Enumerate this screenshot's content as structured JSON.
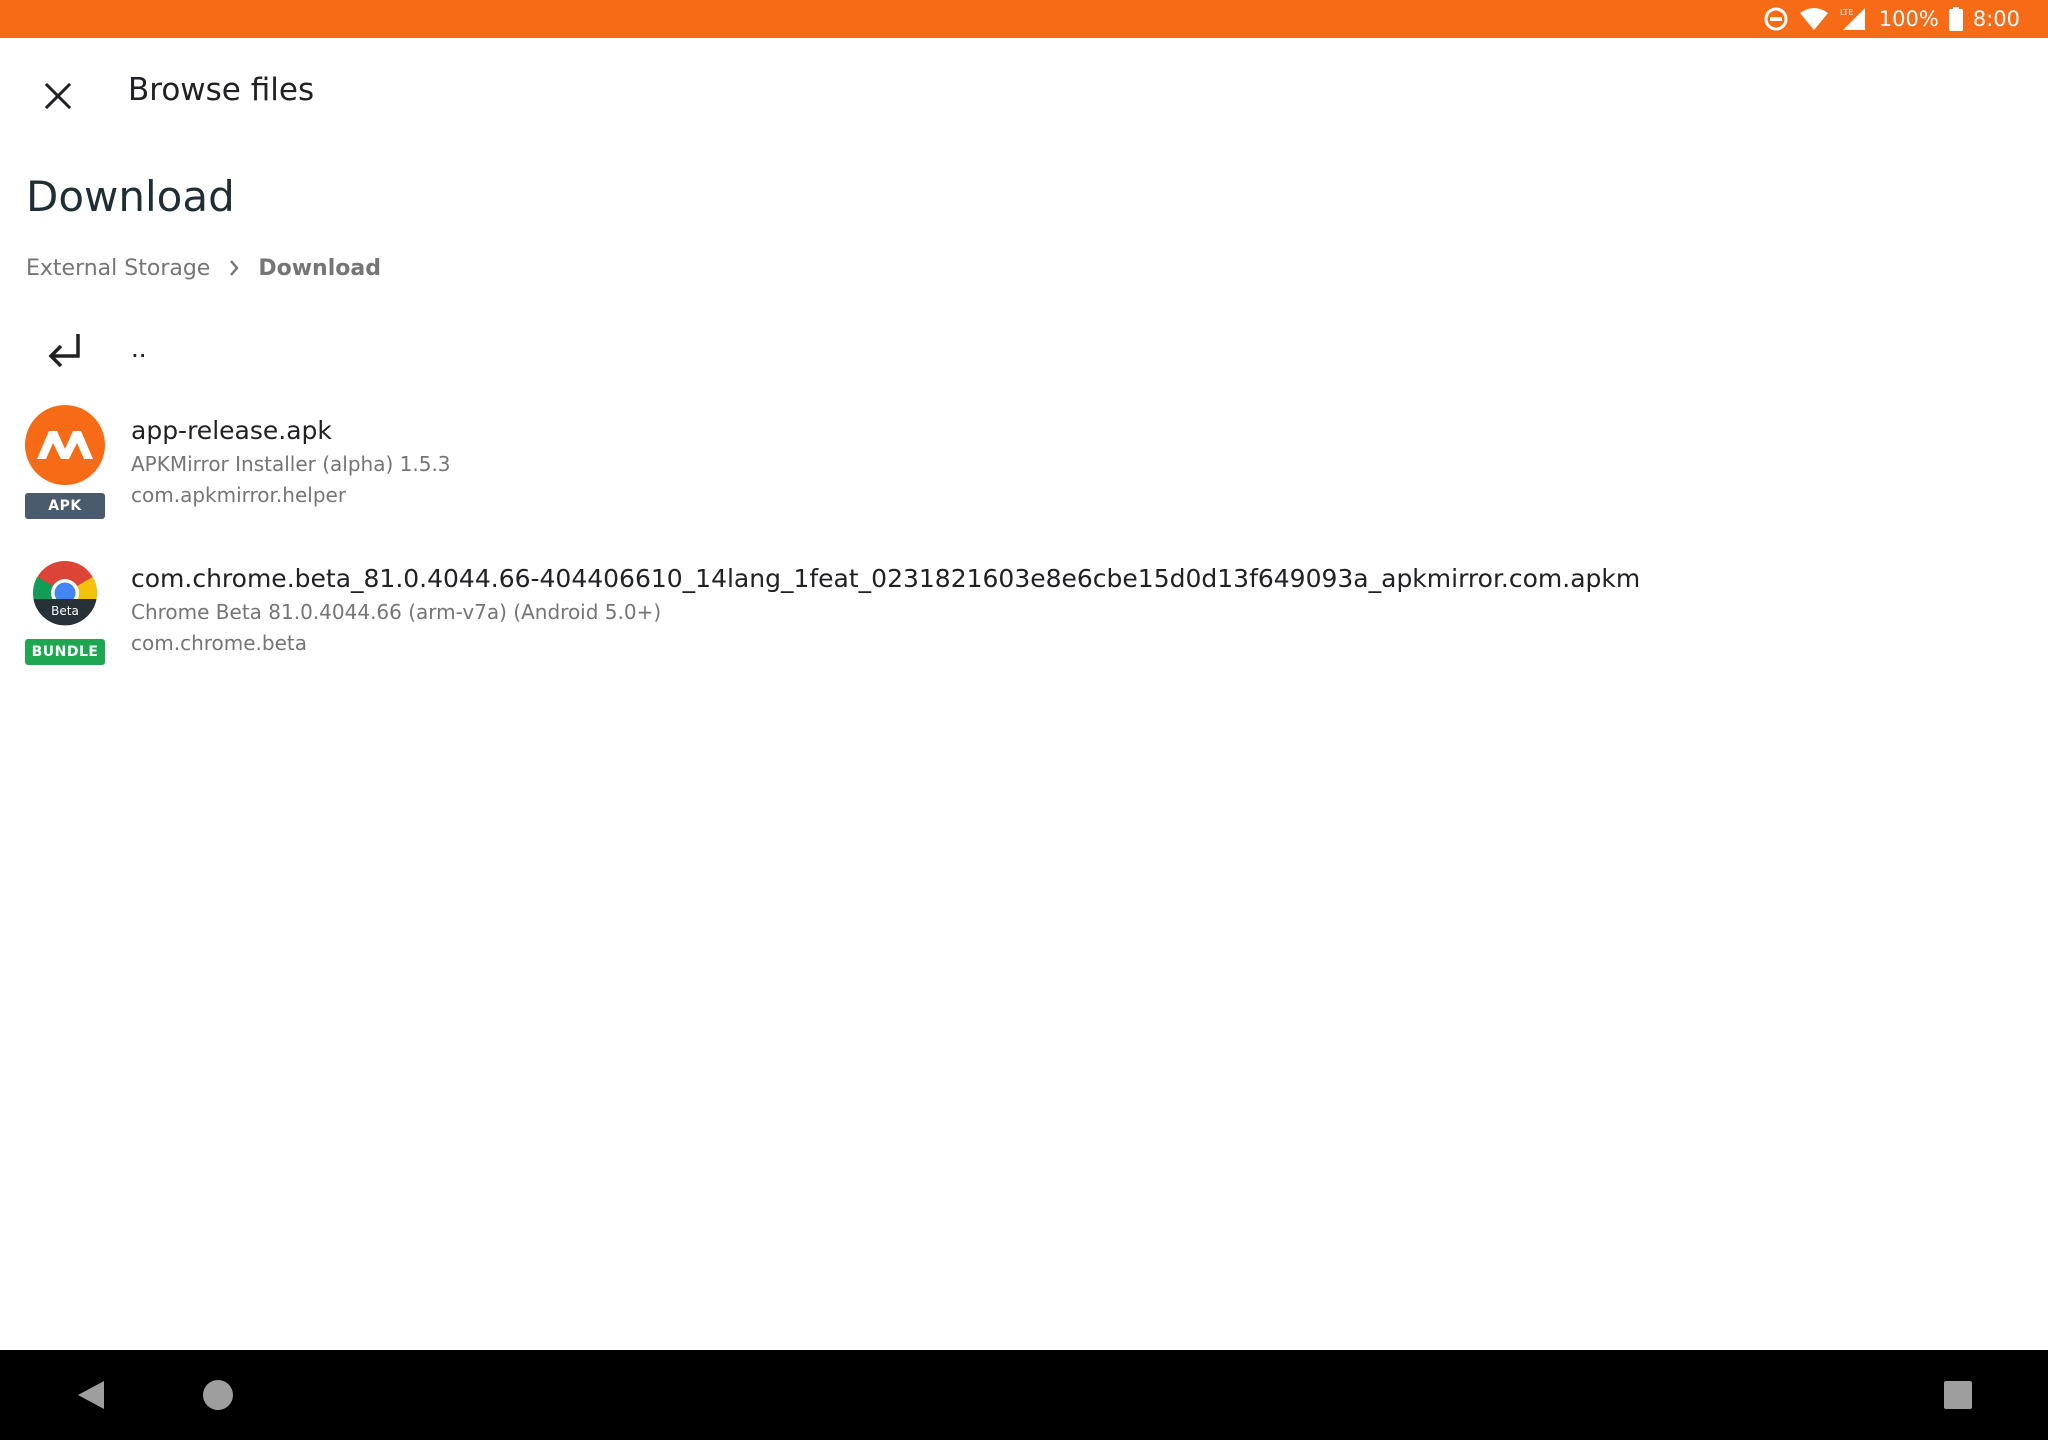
{
  "status_bar": {
    "battery": "100%",
    "time": "8:00",
    "network": "LTE",
    "color": "#f76b17"
  },
  "toolbar": {
    "title": "Browse files"
  },
  "page": {
    "title": "Download"
  },
  "breadcrumb": {
    "items": [
      "External Storage",
      "Download"
    ]
  },
  "parent_row": {
    "label": ".."
  },
  "files": [
    {
      "name": "app-release.apk",
      "app_label": "APKMirror Installer (alpha) 1.5.3",
      "package": "com.apkmirror.helper",
      "badge": "APK",
      "badge_color": "#4b5b6e",
      "icon": "apkmirror-icon"
    },
    {
      "name": "com.chrome.beta_81.0.4044.66-404406610_14lang_1feat_0231821603e8e6cbe15d0d13f649093a_apkmirror.com.apkm",
      "app_label": "Chrome Beta 81.0.4044.66 (arm-v7a) (Android 5.0+)",
      "package": "com.chrome.beta",
      "badge": "BUNDLE",
      "badge_color": "#1ea650",
      "icon": "chrome-beta-icon",
      "icon_text": "Beta"
    }
  ]
}
